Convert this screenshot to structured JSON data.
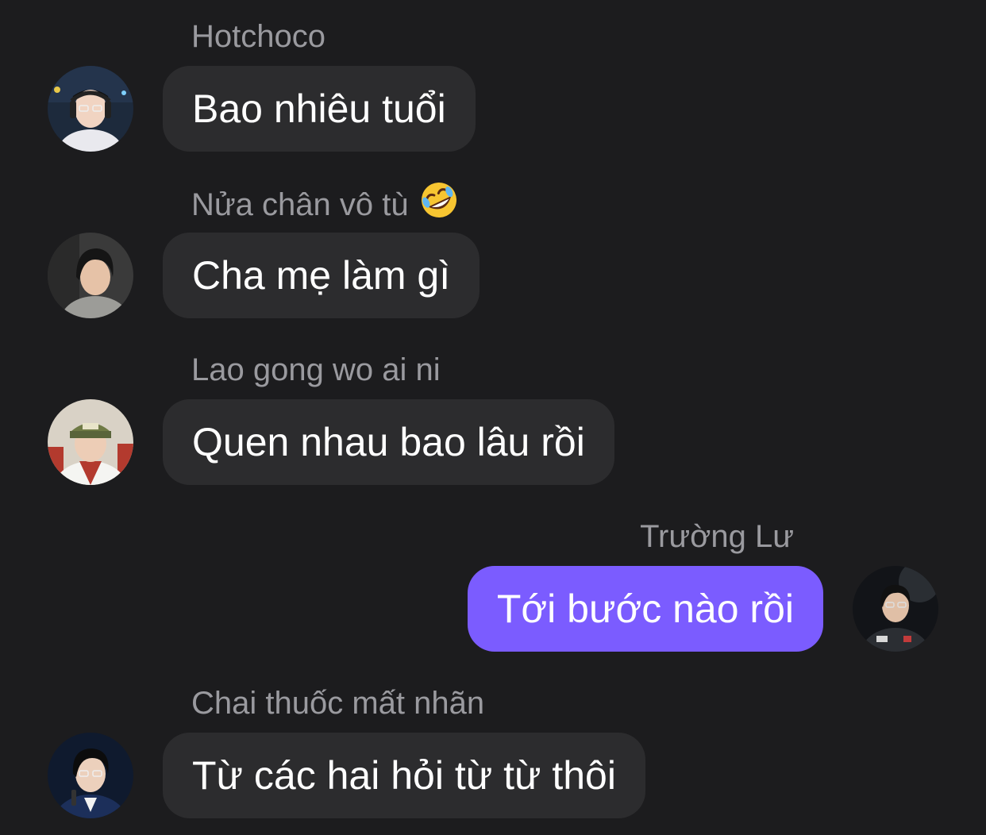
{
  "colors": {
    "background": "#1c1c1e",
    "incoming_bubble": "#2c2c2e",
    "outgoing_bubble": "#7b5cff",
    "sender_name": "#9a9a9f",
    "message_text": "#ffffff"
  },
  "messages": [
    {
      "sender": "Hotchoco",
      "text": "Bao nhiêu tuổi",
      "outgoing": false,
      "avatar_icon": "avatar-photo"
    },
    {
      "sender": "Nửa chân vô tù",
      "sender_emoji": "rolling-on-floor-laughing-emoji",
      "text": "Cha mẹ làm gì",
      "outgoing": false,
      "avatar_icon": "avatar-photo"
    },
    {
      "sender": "Lao gong wo ai ni",
      "text": "Quen nhau bao lâu rồi",
      "outgoing": false,
      "avatar_icon": "avatar-photo"
    },
    {
      "sender": "Trường Lư",
      "text": "Tới bước nào rồi",
      "outgoing": true,
      "avatar_icon": "avatar-photo"
    },
    {
      "sender": "Chai thuốc mất nhãn",
      "text": "Từ các hai hỏi từ từ thôi",
      "outgoing": false,
      "avatar_icon": "avatar-photo"
    }
  ]
}
